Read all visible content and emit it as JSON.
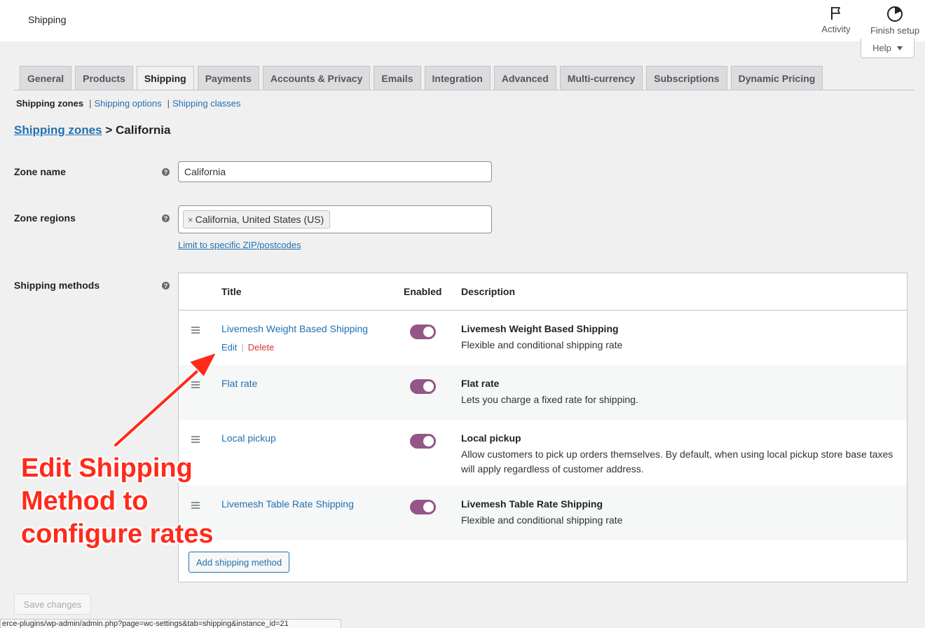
{
  "header": {
    "title": "Shipping",
    "activity_label": "Activity",
    "finish_setup_label": "Finish setup",
    "help_label": "Help"
  },
  "tabs": [
    {
      "label": "General",
      "active": false
    },
    {
      "label": "Products",
      "active": false
    },
    {
      "label": "Shipping",
      "active": true
    },
    {
      "label": "Payments",
      "active": false
    },
    {
      "label": "Accounts & Privacy",
      "active": false
    },
    {
      "label": "Emails",
      "active": false
    },
    {
      "label": "Integration",
      "active": false
    },
    {
      "label": "Advanced",
      "active": false
    },
    {
      "label": "Multi-currency",
      "active": false
    },
    {
      "label": "Subscriptions",
      "active": false
    },
    {
      "label": "Dynamic Pricing",
      "active": false
    }
  ],
  "subnav": {
    "current": "Shipping zones",
    "links": [
      "Shipping options",
      "Shipping classes"
    ],
    "separator": "|"
  },
  "breadcrumb": {
    "link": "Shipping zones",
    "separator": ">",
    "current": "California"
  },
  "form": {
    "zone_name_label": "Zone name",
    "zone_name_value": "California",
    "zone_regions_label": "Zone regions",
    "region_chip": "California, United States (US)",
    "region_chip_remove": "×",
    "limit_zip_link": "Limit to specific ZIP/postcodes",
    "shipping_methods_label": "Shipping methods",
    "help_glyph": "?"
  },
  "methods_table": {
    "headers": {
      "title": "Title",
      "enabled": "Enabled",
      "description": "Description"
    },
    "rows": [
      {
        "title": "Livemesh Weight Based Shipping",
        "enabled": true,
        "desc_title": "Livemesh Weight Based Shipping",
        "desc_text": "Flexible and conditional shipping rate",
        "actions": {
          "edit": "Edit",
          "separator": "|",
          "delete": "Delete"
        }
      },
      {
        "title": "Flat rate",
        "enabled": true,
        "desc_title": "Flat rate",
        "desc_text": "Lets you charge a fixed rate for shipping."
      },
      {
        "title": "Local pickup",
        "enabled": true,
        "desc_title": "Local pickup",
        "desc_text": "Allow customers to pick up orders themselves. By default, when using local pickup store base taxes will apply regardless of customer address."
      },
      {
        "title": "Livemesh Table Rate Shipping",
        "enabled": true,
        "desc_title": "Livemesh Table Rate Shipping",
        "desc_text": "Flexible and conditional shipping rate"
      }
    ],
    "add_button": "Add shipping method"
  },
  "save_button": "Save changes",
  "status_url": "erce-plugins/wp-admin/admin.php?page=wc-settings&tab=shipping&instance_id=21",
  "annotation": {
    "lines": [
      "Edit Shipping",
      "Method to",
      "configure rates"
    ],
    "color": "#ff2a1a"
  },
  "colors": {
    "link": "#2271b1",
    "toggle_on": "#935687",
    "delete": "#d63638"
  }
}
